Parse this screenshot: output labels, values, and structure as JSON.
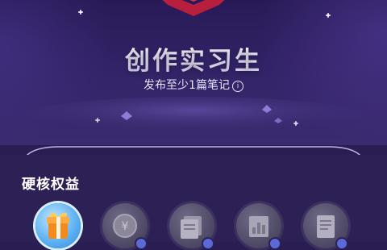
{
  "badge": {
    "title": "创作实习生",
    "subtitle": "发布至少1篇笔记",
    "info_icon": "info-icon"
  },
  "perks_section": {
    "title": "硬核权益",
    "items": [
      {
        "icon": "gift-icon",
        "active": true
      },
      {
        "icon": "yen-coin-icon",
        "active": false
      },
      {
        "icon": "document-stack-icon",
        "active": false
      },
      {
        "icon": "chart-icon",
        "active": false
      },
      {
        "icon": "notebook-icon",
        "active": false
      }
    ]
  },
  "colors": {
    "background": "#2a1d52",
    "badge_red": "#e8405a",
    "gift_orange": "#f39a2b",
    "gift_blue": "#59aef2"
  }
}
